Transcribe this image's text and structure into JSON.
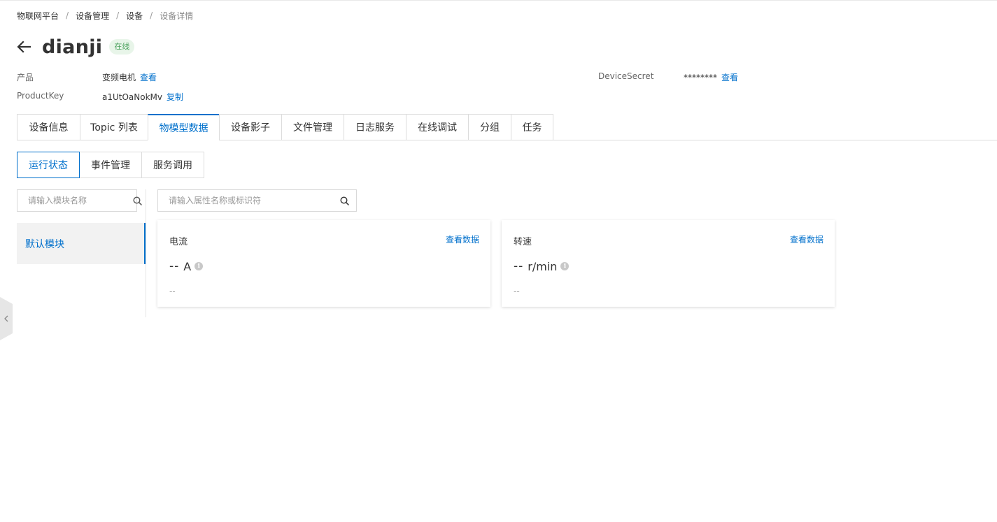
{
  "breadcrumb": {
    "items": [
      "物联网平台",
      "设备管理",
      "设备",
      "设备详情"
    ],
    "separator": "/"
  },
  "device": {
    "name": "dianji",
    "status": "在线"
  },
  "info": {
    "product_label": "产品",
    "product_value": "变频电机",
    "product_link": "查看",
    "productkey_label": "ProductKey",
    "productkey_value": "a1UtOaNokMv",
    "productkey_link": "复制",
    "secret_label": "DeviceSecret",
    "secret_value": "********",
    "secret_link": "查看"
  },
  "tabs": [
    {
      "label": "设备信息"
    },
    {
      "label": "Topic 列表"
    },
    {
      "label": "物模型数据",
      "active": true
    },
    {
      "label": "设备影子"
    },
    {
      "label": "文件管理"
    },
    {
      "label": "日志服务"
    },
    {
      "label": "在线调试"
    },
    {
      "label": "分组"
    },
    {
      "label": "任务"
    }
  ],
  "subtabs": [
    {
      "label": "运行状态",
      "active": true
    },
    {
      "label": "事件管理"
    },
    {
      "label": "服务调用"
    }
  ],
  "module_search": {
    "placeholder": "请输入模块名称"
  },
  "property_search": {
    "placeholder": "请输入属性名称或标识符"
  },
  "modules": [
    {
      "label": "默认模块",
      "active": true
    }
  ],
  "properties": [
    {
      "name": "电流",
      "link": "查看数据",
      "value": "--",
      "unit": "A",
      "info_icon": "i",
      "time": "--"
    },
    {
      "name": "转速",
      "link": "查看数据",
      "value": "--",
      "unit": "r/min",
      "info_icon": "i",
      "time": "--"
    }
  ],
  "colors": {
    "accent": "#0070cc",
    "online_bg": "#e8f5e9",
    "online_text": "#47a05a",
    "border": "#dcdcdc"
  },
  "icons": {
    "back": "back-arrow-icon",
    "search": "search-icon",
    "info": "info-icon",
    "collapse": "chevron-left-icon"
  }
}
